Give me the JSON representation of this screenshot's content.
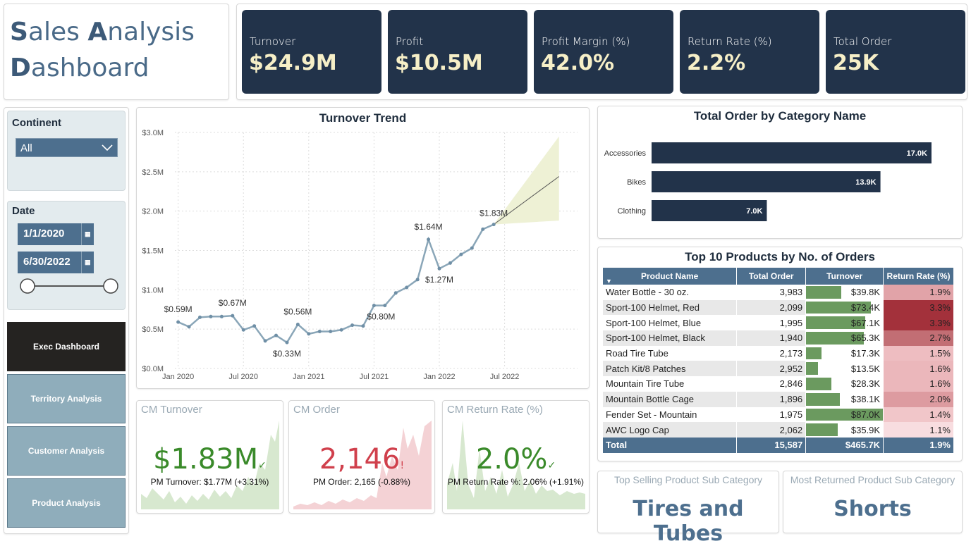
{
  "title": {
    "line1_first": "S",
    "line1_rest": "ales ",
    "line1_second": "A",
    "line1_rest2": "nalysis",
    "line2_first": "D",
    "line2_rest": "ashboard"
  },
  "kpis": [
    {
      "label": "Turnover",
      "value": "$24.9M"
    },
    {
      "label": "Profit",
      "value": "$10.5M"
    },
    {
      "label": "Profit Margin (%)",
      "value": "42.0%"
    },
    {
      "label": "Return Rate (%)",
      "value": "2.2%"
    },
    {
      "label": "Total Order",
      "value": "25K"
    }
  ],
  "filters": {
    "continent_label": "Continent",
    "continent_value": "All",
    "date_label": "Date",
    "date_from": "1/1/2020",
    "date_to": "6/30/2022"
  },
  "nav": {
    "exec": "Exec Dashboard",
    "territory": "Territory Analysis",
    "customer": "Customer Analysis",
    "product": "Product Analysis"
  },
  "turnover_trend": {
    "title": "Turnover Trend",
    "y_ticks": [
      "$0.0M",
      "$0.5M",
      "$1.0M",
      "$1.5M",
      "$2.0M",
      "$2.5M",
      "$3.0M"
    ],
    "x_ticks": [
      "Jan 2020",
      "Jul 2020",
      "Jan 2021",
      "Jul 2021",
      "Jan 2022",
      "Jul 2022"
    ],
    "labels": [
      "$0.59M",
      "$0.67M",
      "$0.56M",
      "$0.33M",
      "$0.80M",
      "$1.64M",
      "$1.27M",
      "$1.83M"
    ]
  },
  "chart_data": [
    {
      "type": "line",
      "title": "Turnover Trend",
      "xlabel": "",
      "ylabel": "",
      "ylim": [
        0,
        3.0
      ],
      "y_unit": "$M",
      "x": [
        "2020-01",
        "2020-02",
        "2020-03",
        "2020-04",
        "2020-05",
        "2020-06",
        "2020-07",
        "2020-08",
        "2020-09",
        "2020-10",
        "2020-11",
        "2020-12",
        "2021-01",
        "2021-02",
        "2021-03",
        "2021-04",
        "2021-05",
        "2021-06",
        "2021-07",
        "2021-08",
        "2021-09",
        "2021-10",
        "2021-11",
        "2021-12",
        "2022-01",
        "2022-02",
        "2022-03",
        "2022-04",
        "2022-05",
        "2022-06"
      ],
      "series": [
        {
          "values": [
            0.59,
            0.53,
            0.65,
            0.66,
            0.66,
            0.67,
            0.49,
            0.54,
            0.35,
            0.42,
            0.33,
            0.56,
            0.44,
            0.47,
            0.47,
            0.49,
            0.55,
            0.54,
            0.8,
            0.8,
            0.96,
            1.03,
            1.13,
            1.64,
            1.27,
            1.34,
            1.45,
            1.53,
            1.77,
            1.83
          ]
        }
      ],
      "forecast": {
        "start": "2022-06",
        "end": "2022-12",
        "line_end": 2.44,
        "upper_end": 2.95,
        "lower_end": 1.88
      },
      "grid": true
    },
    {
      "type": "bar",
      "title": "Total Order by Category Name",
      "orientation": "horizontal",
      "categories": [
        "Accessories",
        "Bikes",
        "Clothing"
      ],
      "values": [
        17.0,
        13.9,
        7.0
      ],
      "value_labels": [
        "17.0K",
        "13.9K",
        "7.0K"
      ],
      "xlim": [
        0,
        18.5
      ]
    }
  ],
  "category_chart": {
    "title": "Total Order by Category Name"
  },
  "top_products": {
    "title": "Top 10 Products by No. of Orders",
    "columns": [
      "Product Name",
      "Total Order",
      "Turnover",
      "Return Rate (%)"
    ],
    "rows": [
      {
        "name": "Water Bottle - 30 oz.",
        "orders": "3,983",
        "turnover": "$39.8K",
        "turnover_val": 39.8,
        "rr": "1.9%",
        "rr_color": "#e1a3a8"
      },
      {
        "name": "Sport-100 Helmet, Red",
        "orders": "2,099",
        "turnover": "$73.4K",
        "turnover_val": 73.4,
        "rr": "3.3%",
        "rr_color": "#a3313b"
      },
      {
        "name": "Sport-100 Helmet, Blue",
        "orders": "1,995",
        "turnover": "$67.1K",
        "turnover_val": 67.1,
        "rr": "3.3%",
        "rr_color": "#a3313b"
      },
      {
        "name": "Sport-100 Helmet, Black",
        "orders": "1,940",
        "turnover": "$65.3K",
        "turnover_val": 65.3,
        "rr": "2.7%",
        "rr_color": "#c26e74"
      },
      {
        "name": "Road Tire Tube",
        "orders": "2,173",
        "turnover": "$17.3K",
        "turnover_val": 17.3,
        "rr": "1.5%",
        "rr_color": "#eebdc1"
      },
      {
        "name": "Patch Kit/8 Patches",
        "orders": "2,952",
        "turnover": "$13.5K",
        "turnover_val": 13.5,
        "rr": "1.6%",
        "rr_color": "#ebb7bb"
      },
      {
        "name": "Mountain Tire Tube",
        "orders": "2,846",
        "turnover": "$28.3K",
        "turnover_val": 28.3,
        "rr": "1.6%",
        "rr_color": "#ebb7bb"
      },
      {
        "name": "Mountain Bottle Cage",
        "orders": "1,896",
        "turnover": "$38.1K",
        "turnover_val": 38.1,
        "rr": "2.0%",
        "rr_color": "#dd9ba0"
      },
      {
        "name": "Fender Set - Mountain",
        "orders": "1,975",
        "turnover": "$87.0K",
        "turnover_val": 87.0,
        "rr": "1.4%",
        "rr_color": "#f1c6c9"
      },
      {
        "name": "AWC Logo Cap",
        "orders": "2,062",
        "turnover": "$35.9K",
        "turnover_val": 35.9,
        "rr": "1.1%",
        "rr_color": "#f8dde0"
      }
    ],
    "total": {
      "label": "Total",
      "orders": "15,587",
      "turnover": "$465.7K",
      "rr": "1.9%"
    }
  },
  "cm_turnover": {
    "title": "CM Turnover",
    "value": "$1.83M",
    "mark": "✓",
    "sub": "PM Turnover: $1.77M (+3.31%)",
    "color": "#3a8a2a"
  },
  "cm_order": {
    "title": "CM Order",
    "value": "2,146",
    "mark": "!",
    "sub": "PM Order: 2,165 (-0.88%)",
    "color": "#d0404c"
  },
  "cm_return": {
    "title": "CM Return Rate (%)",
    "value": "2.0%",
    "mark": "✓",
    "sub": "PM Return Rate %: 2.06% (+1.91%)",
    "color": "#3a8a2a"
  },
  "top_selling": {
    "title": "Top Selling Product Sub Category",
    "value": "Tires and Tubes"
  },
  "most_returned": {
    "title": "Most Returned Product Sub Category",
    "value": "Shorts"
  },
  "colors": {
    "navy": "#22334a",
    "steel": "#4d6f8e",
    "cream": "#f6efc7",
    "green": "#6b9a5f",
    "red": "#a3313b"
  }
}
